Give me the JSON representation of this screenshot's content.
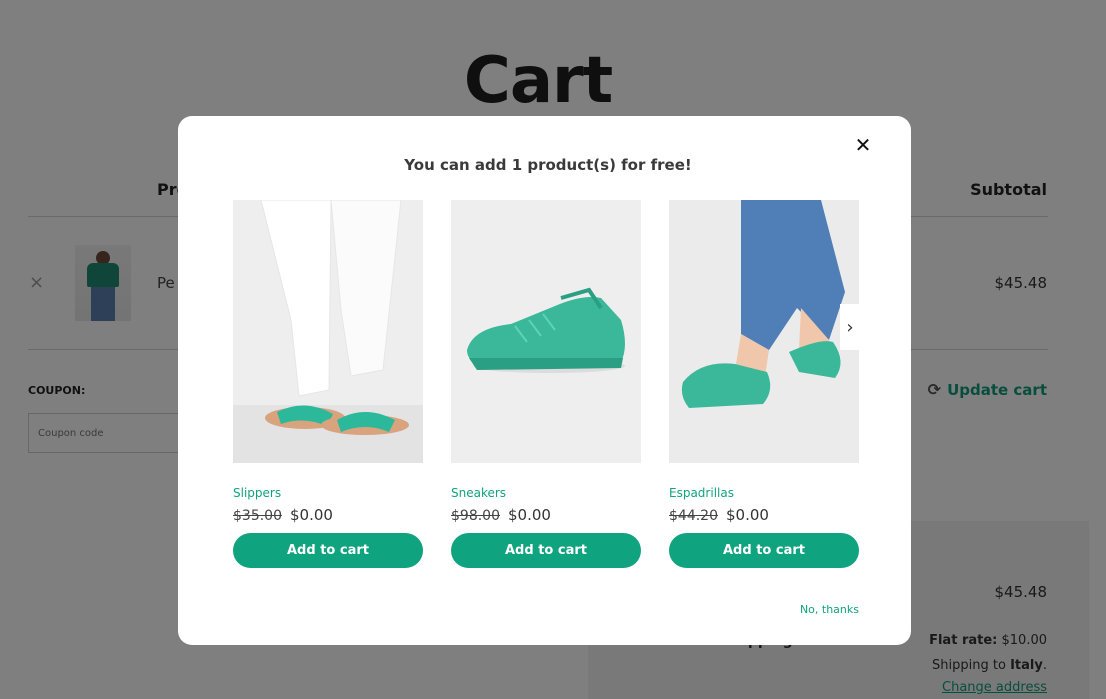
{
  "page": {
    "title": "Cart",
    "columns": {
      "product": "Product",
      "subtotal": "Subtotal"
    },
    "item": {
      "remove_glyph": "×",
      "name": "Pe",
      "subtotal": "$45.48"
    },
    "coupon": {
      "label": "COUPON:",
      "placeholder": "Coupon code"
    },
    "update_cart": {
      "label": "Update cart",
      "icon": "refresh-icon"
    },
    "totals": {
      "subtotal": "$45.48",
      "shipping_label": "Shipping",
      "rate_label": "Flat rate:",
      "rate_value": "$10.00",
      "shipping_to_prefix": "Shipping to",
      "shipping_country": "Italy",
      "change_address": "Change address"
    }
  },
  "modal": {
    "title": "You can add 1 product(s) for free!",
    "close_glyph": "✕",
    "next_glyph": "›",
    "no_thanks": "No, thanks",
    "products": [
      {
        "name": "Slippers",
        "old_price": "$35.00",
        "new_price": "$0.00",
        "button": "Add to cart"
      },
      {
        "name": "Sneakers",
        "old_price": "$98.00",
        "new_price": "$0.00",
        "button": "Add to cart"
      },
      {
        "name": "Espadrillas",
        "old_price": "$44.20",
        "new_price": "$0.00",
        "button": "Add to cart"
      }
    ]
  },
  "colors": {
    "accent": "#10a37f",
    "overlay": "rgba(0,0,0,0.5)"
  }
}
